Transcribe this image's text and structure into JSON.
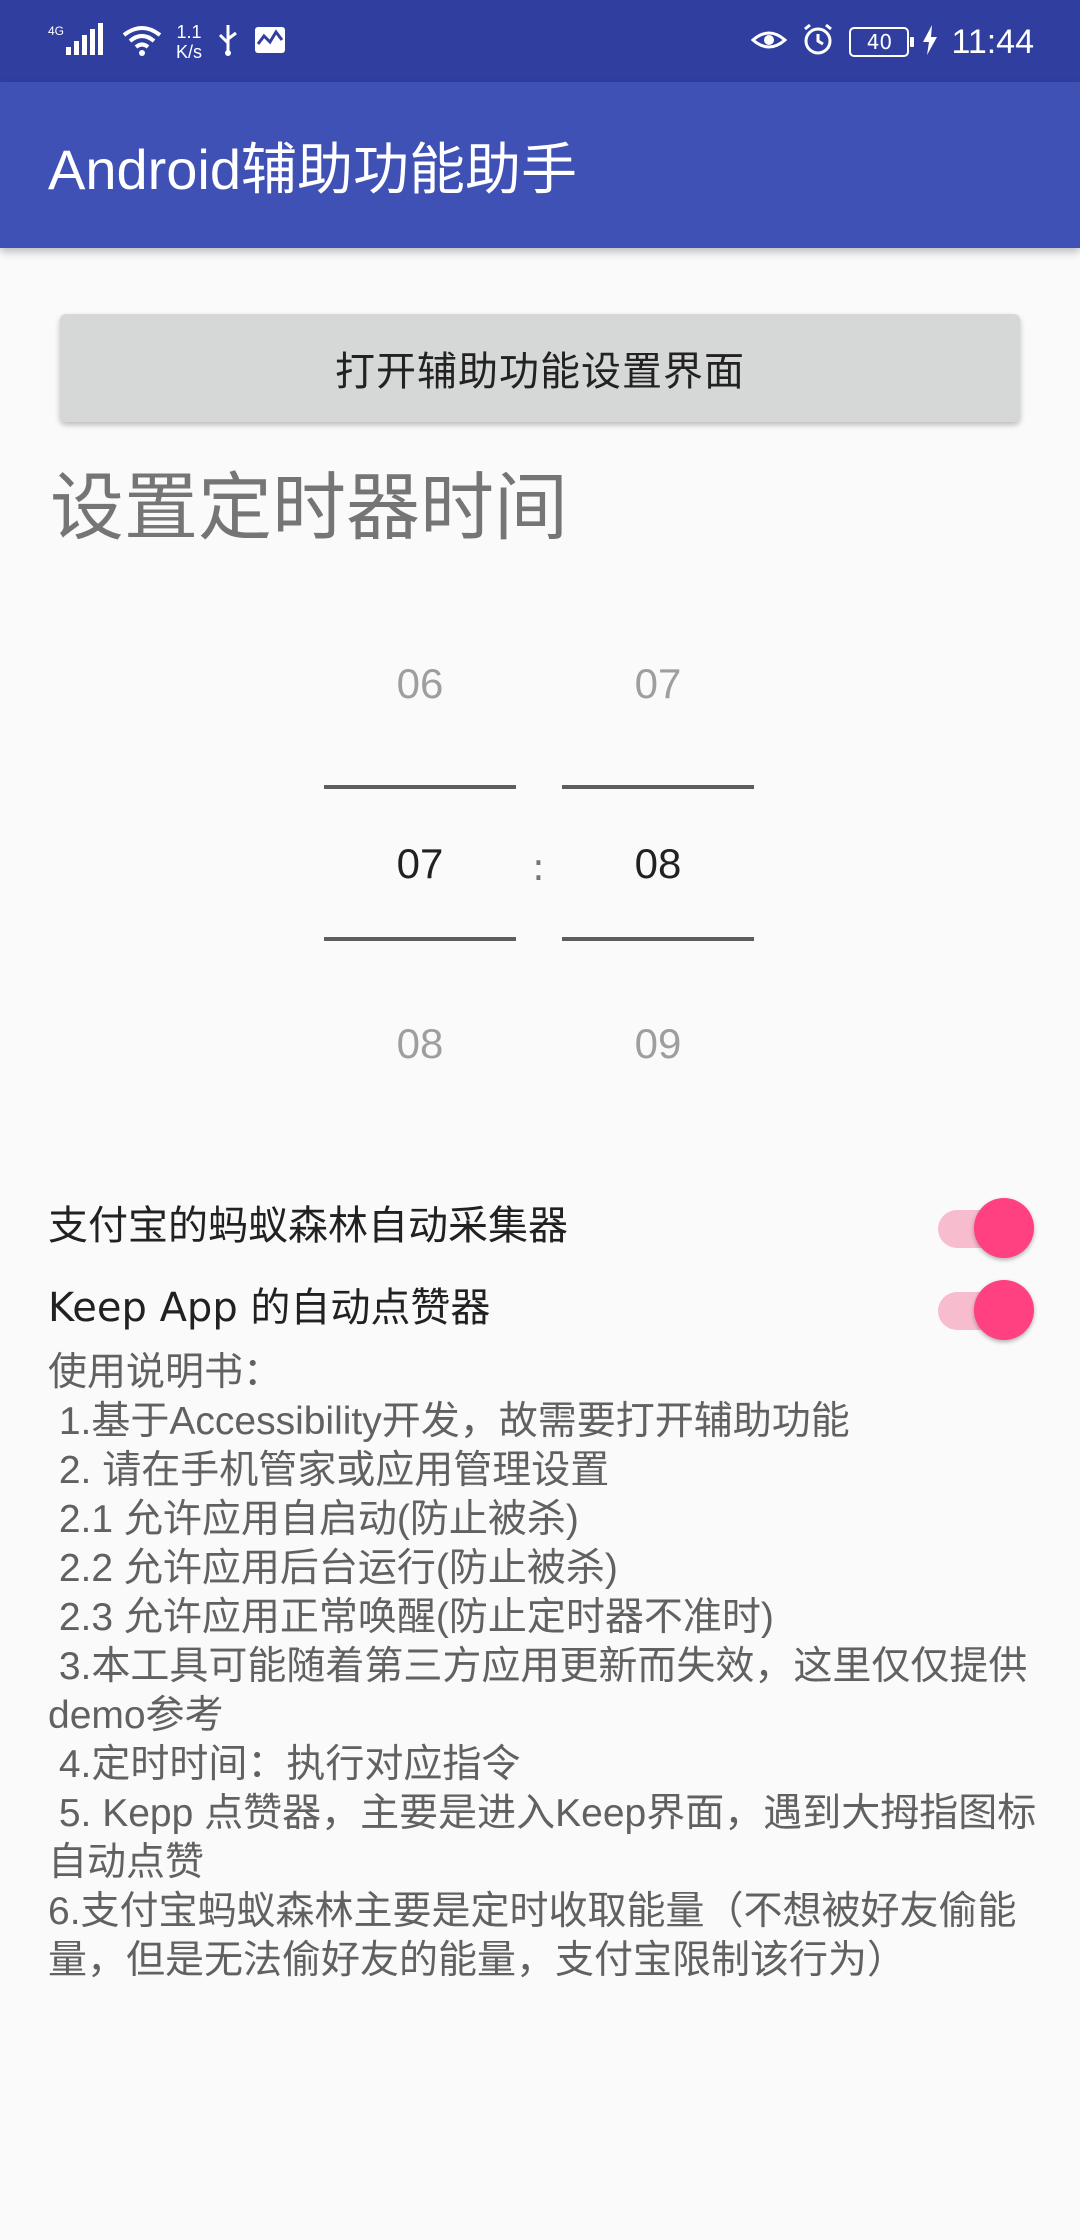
{
  "status_bar": {
    "network_type": "4G",
    "speed_value": "1.1",
    "speed_unit": "K/s",
    "battery_level": "40",
    "time": "11:44"
  },
  "toolbar": {
    "title": "Android辅助功能助手"
  },
  "main": {
    "open_settings_button": "打开辅助功能设置界面",
    "timer_title": "设置定时器时间",
    "time_picker": {
      "hour": {
        "prev": "06",
        "selected": "07",
        "next": "08"
      },
      "minute": {
        "prev": "07",
        "selected": "08",
        "next": "09"
      },
      "separator": ":"
    },
    "switches": [
      {
        "label": "支付宝的蚂蚁森林自动采集器",
        "checked": true
      },
      {
        "label": "Keep App 的自动点赞器",
        "checked": true
      }
    ],
    "instructions": [
      "使用说明书：",
      " 1.基于Accessibility开发，故需要打开辅助功能",
      " 2. 请在手机管家或应用管理设置",
      " 2.1 允许应用自启动(防止被杀)",
      " 2.2 允许应用后台运行(防止被杀)",
      " 2.3 允许应用正常唤醒(防止定时器不准时)",
      " 3.本工具可能随着第三方应用更新而失效，这里仅仅提供demo参考",
      " 4.定时时间：执行对应指令",
      " 5. Kepp 点赞器，主要是进入Keep界面，遇到大拇指图标自动点赞",
      "6.支付宝蚂蚁森林主要是定时收取能量（不想被好友偷能量，但是无法偷好友的能量，支付宝限制该行为）"
    ]
  },
  "colors": {
    "status_bar": "#303f9f",
    "toolbar": "#3f51b5",
    "accent": "#ff4081",
    "switch_track": "#f8bccf"
  }
}
